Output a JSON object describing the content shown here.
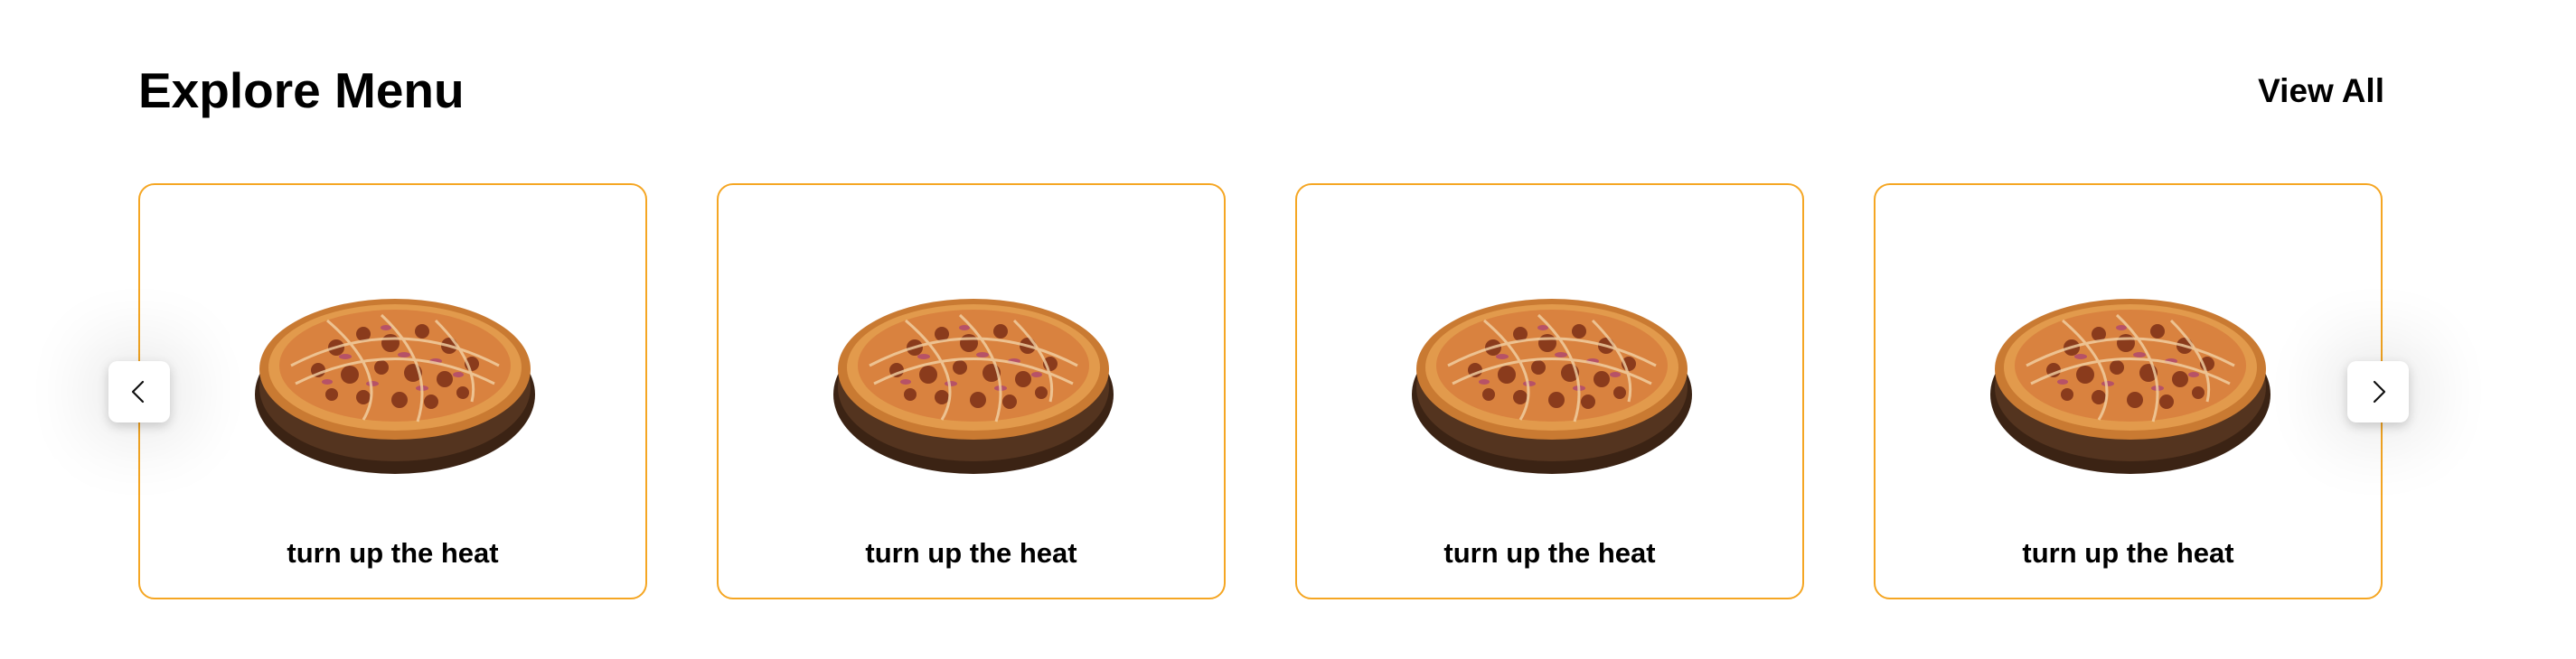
{
  "section": {
    "title": "Explore Menu",
    "view_all_label": "View All"
  },
  "cards": [
    {
      "label": "turn up the heat",
      "icon": "pizza-image"
    },
    {
      "label": "turn up the heat",
      "icon": "pizza-image"
    },
    {
      "label": "turn up the heat",
      "icon": "pizza-image"
    },
    {
      "label": "turn up the heat",
      "icon": "pizza-image"
    }
  ],
  "navigation": {
    "prev_icon": "chevron-left-icon",
    "next_icon": "chevron-right-icon"
  },
  "colors": {
    "card_border": "#f5a623",
    "text": "#000000",
    "background": "#ffffff"
  }
}
